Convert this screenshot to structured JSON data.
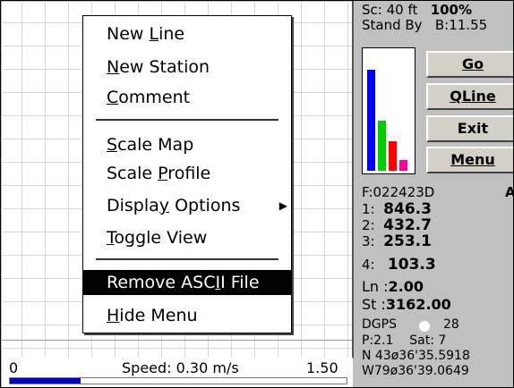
{
  "menu": {
    "items": [
      {
        "pre": "New ",
        "key": "L",
        "post": "ine"
      },
      {
        "pre": "",
        "key": "N",
        "post": "ew Station"
      },
      {
        "pre": "",
        "key": "C",
        "post": "omment"
      },
      {
        "pre": "",
        "key": "S",
        "post": "cale Map"
      },
      {
        "pre": "Scale ",
        "key": "P",
        "post": "rofile"
      },
      {
        "pre": "Displa",
        "key": "y",
        "post": " Options"
      },
      {
        "pre": "",
        "key": "T",
        "post": "oggle View"
      },
      {
        "pre": "Remove ASC",
        "key": "I",
        "post": "I File"
      },
      {
        "pre": "",
        "key": "H",
        "post": "ide Menu"
      }
    ],
    "submenu_arrow": "▶"
  },
  "speed": {
    "min": "0",
    "label": "Speed: 0.30 m/s",
    "max": "1.50",
    "fraction": 0.21,
    "fill_color": "#0000cc"
  },
  "panel": {
    "scale_prefix": "Sc:",
    "scale_value": "40 ft",
    "zoom": "100%",
    "status": "Stand By",
    "battery": "B:11.55",
    "buttons": {
      "go": "Go",
      "qline": "QLine",
      "exit": "Exit",
      "menu": "Menu"
    },
    "file": "F:022423D",
    "mode": "A",
    "readings": [
      {
        "label": "1:",
        "value": "846.3"
      },
      {
        "label": "2:",
        "value": "432.7"
      },
      {
        "label": "3:",
        "value": "253.1"
      },
      {
        "label": "4:",
        "value": "103.3"
      }
    ],
    "line_label": "Ln :",
    "line_value": "2.00",
    "station_label": "St :",
    "station_value": "3162.00",
    "dgps_label": "DGPS",
    "dgps_value": "28",
    "pdop": "P:2.1",
    "sats": "Sat: 7",
    "latitude": "N 43ø36'35.5918",
    "longitude": "W79ø36'39.0649"
  },
  "signal_bars": [
    {
      "color": "#0000ff",
      "level": 0.88
    },
    {
      "color": "#00cc00",
      "level": 0.44
    },
    {
      "color": "#ff0000",
      "level": 0.26
    },
    {
      "color": "#ff0099",
      "level": 0.09
    }
  ]
}
